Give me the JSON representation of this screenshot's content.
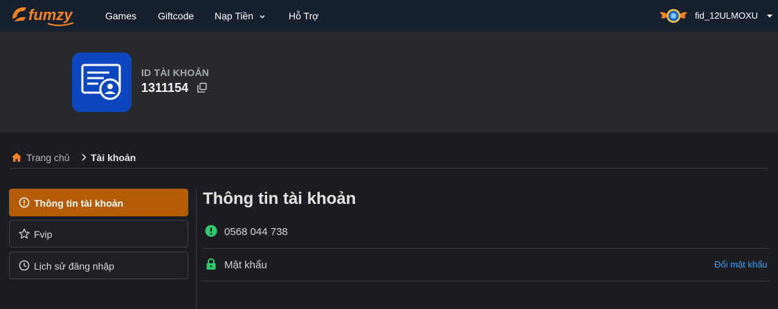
{
  "brand": {
    "logo_text": "fumzy",
    "accent": "#f58220"
  },
  "nav": {
    "items": [
      {
        "label": "Games"
      },
      {
        "label": "Giftcode"
      },
      {
        "label": "Nạp Tiền"
      },
      {
        "label": "Hỗ Trợ"
      }
    ],
    "username": "fid_12ULMOXU"
  },
  "account": {
    "id_label": "ID TÀI KHOẢN",
    "id_value": "1311154"
  },
  "breadcrumb": {
    "home": "Trang chủ",
    "current": "Tài khoản"
  },
  "sidebar": {
    "items": [
      {
        "label": "Thông tin tài khoản",
        "icon": "info-circle-icon",
        "active": true
      },
      {
        "label": "Fvip",
        "icon": "star-icon",
        "active": false
      },
      {
        "label": "Lịch sử đăng nhập",
        "icon": "clock-icon",
        "active": false
      }
    ]
  },
  "main": {
    "title": "Thông tin tài khoản",
    "phone": "0568 044 738",
    "password_label": "Mật khẩu",
    "change_password": "Đổi mật khẩu"
  },
  "colors": {
    "navbar": "#17212e",
    "hero": "#27292d",
    "active_tab": "#b45b06",
    "id_card": "#0d47c0",
    "success": "#2ecc71",
    "link": "#3e9cf0"
  }
}
